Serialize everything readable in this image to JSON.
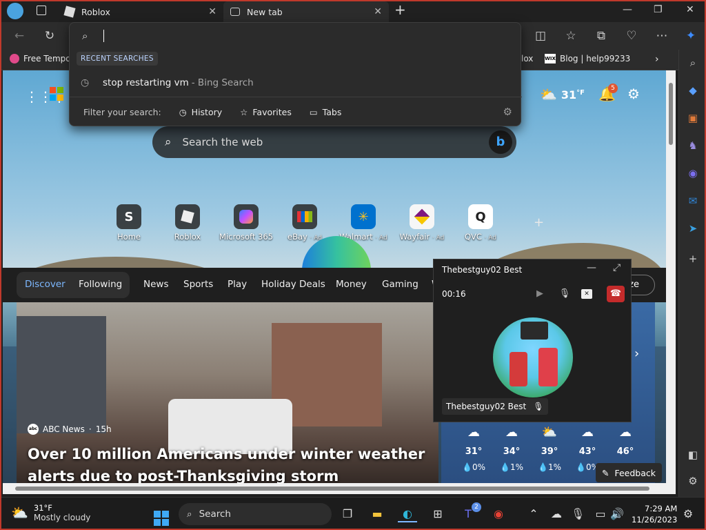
{
  "tabs": [
    {
      "title": "Roblox"
    },
    {
      "title": "New tab"
    }
  ],
  "favorites": {
    "item1": "Free Tempo",
    "item2_suffix": "lox",
    "item3": "Blog | help99233"
  },
  "address_dropdown": {
    "query": "",
    "recent_header": "RECENT SEARCHES",
    "recent_item": {
      "text": "stop restarting vm",
      "suffix": "- Bing Search"
    },
    "filter_label": "Filter your search:",
    "filters": [
      "History",
      "Favorites",
      "Tabs"
    ]
  },
  "newtab": {
    "weather_temp": "31",
    "weather_unit": "°F",
    "notifications": "5",
    "search_placeholder": "Search the web",
    "quicklinks": [
      {
        "letter": "S",
        "label": "Home",
        "ad": ""
      },
      {
        "letter": "",
        "label": "Roblox",
        "ad": ""
      },
      {
        "letter": "",
        "label": "Microsoft 365",
        "ad": ""
      },
      {
        "letter": "",
        "label": "eBay",
        "ad": "· Ad"
      },
      {
        "letter": "",
        "label": "Walmart",
        "ad": "· Ad"
      },
      {
        "letter": "",
        "label": "Wayfair",
        "ad": "· Ad"
      },
      {
        "letter": "",
        "label": "QVC",
        "ad": "· Ad"
      }
    ],
    "feed_tabs": [
      "Discover",
      "Following"
    ],
    "feed_nav": [
      "News",
      "Sports",
      "Play",
      "Holiday Deals",
      "Money",
      "Gaming",
      "W"
    ],
    "personalize": "lize",
    "news": {
      "source": "ABC News",
      "age": "15h",
      "title": "Over 10 million Americans under winter weather alerts due to post-Thanksgiving storm"
    },
    "forecast": [
      {
        "temp": "31°",
        "precip": "0%"
      },
      {
        "temp": "34°",
        "precip": "1%"
      },
      {
        "temp": "39°",
        "precip": "1%"
      },
      {
        "temp": "43°",
        "precip": "0%"
      },
      {
        "temp": "46°",
        "precip": ""
      }
    ],
    "feedback": "Feedback"
  },
  "call": {
    "title": "Thebestguy02 Best",
    "timer": "00:16",
    "name": "Thebestguy02 Best"
  },
  "taskbar": {
    "weather_temp": "31°F",
    "weather_desc": "Mostly cloudy",
    "search": "Search",
    "teams_badge": "2",
    "time": "7:29 AM",
    "date": "11/26/2023"
  },
  "colors": {
    "accent": "#7db8ff",
    "end_call": "#c42b2b",
    "badge": "#e0552f"
  }
}
